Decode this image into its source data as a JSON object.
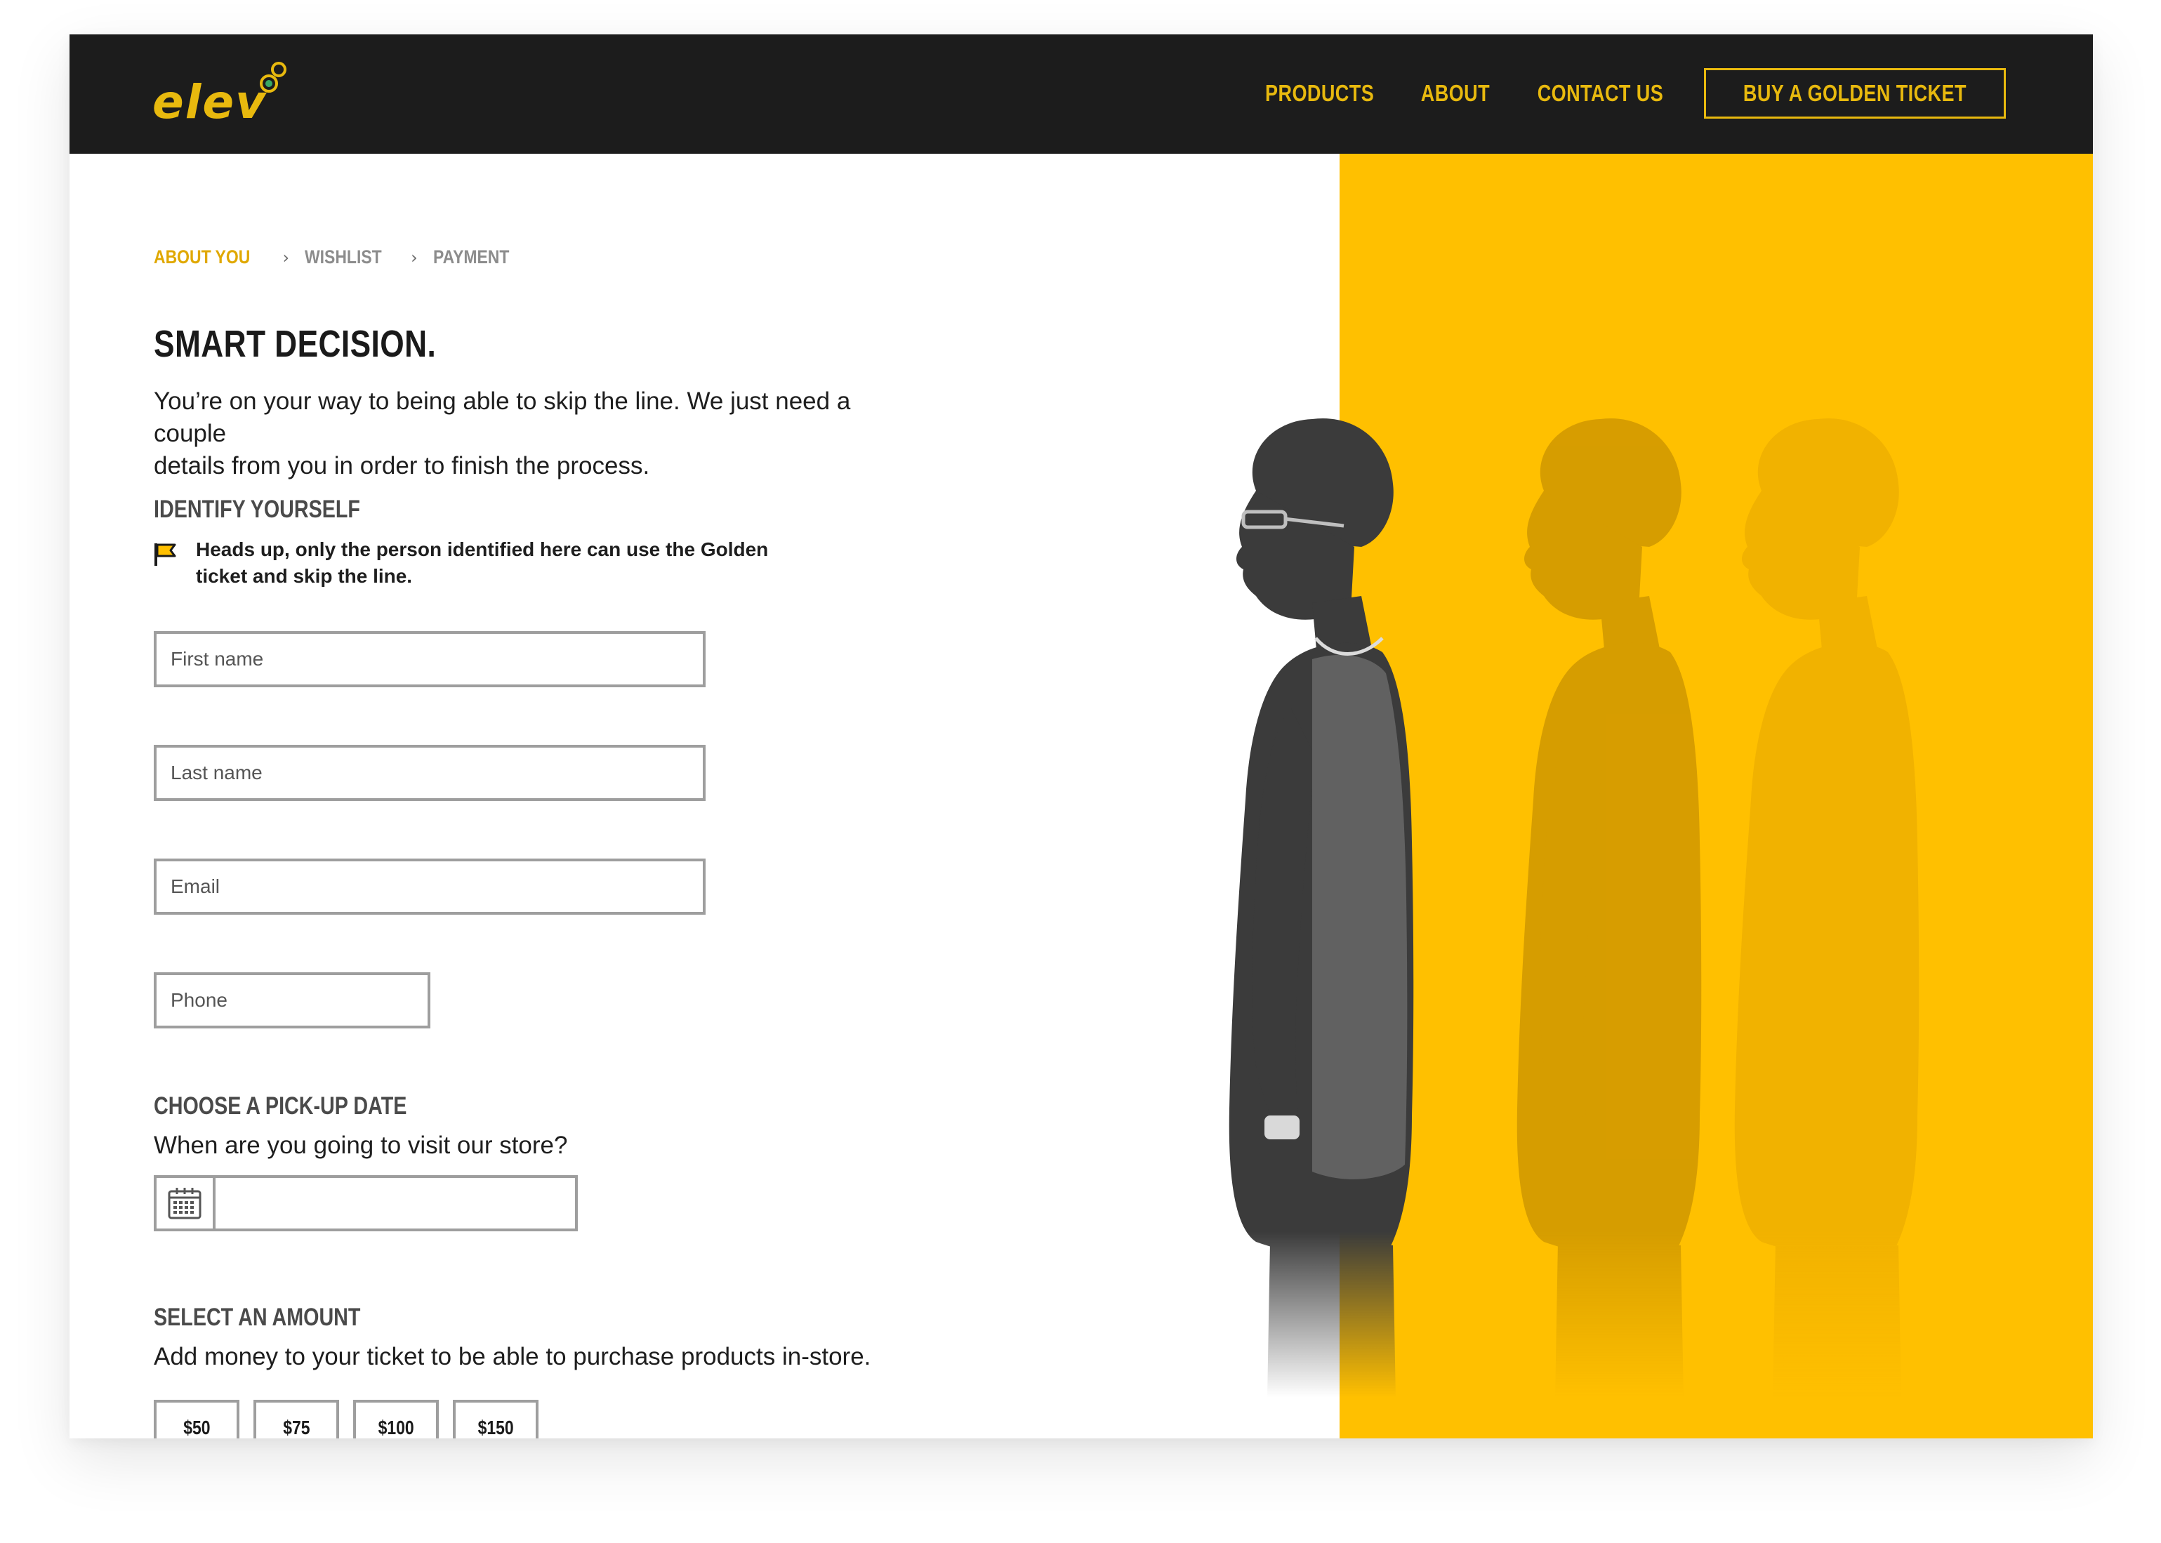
{
  "brand": {
    "logo_text": "elev",
    "accent_color": "#e8b90e",
    "panel_color": "#ffc000",
    "nav_bg": "#1c1c1c"
  },
  "nav": {
    "links": [
      "PRODUCTS",
      "ABOUT",
      "CONTACT US"
    ],
    "cta_label": "BUY A GOLDEN TICKET"
  },
  "breadcrumb": {
    "steps": [
      "ABOUT YOU",
      "WISHLIST",
      "PAYMENT"
    ],
    "active_index": 0,
    "separator_icon": "chevron-right-icon"
  },
  "page": {
    "title": "SMART DECISION.",
    "intro_line_1": "You’re on your way to being able to skip the line. We just need a couple",
    "intro_line_2": "details from you in order to finish the process."
  },
  "identify": {
    "heading": "IDENTIFY YOURSELF",
    "notice_icon": "flag-icon",
    "notice_line_1": "Heads up, only the person identified here can use the Golden",
    "notice_line_2": "ticket and skip the line.",
    "fields": {
      "first_name": {
        "placeholder": "First name",
        "value": ""
      },
      "last_name": {
        "placeholder": "Last name",
        "value": ""
      },
      "email": {
        "placeholder": "Email",
        "value": ""
      },
      "phone": {
        "placeholder": "Phone",
        "value": ""
      }
    }
  },
  "pickup": {
    "heading": "CHOOSE A PICK-UP DATE",
    "subtitle": "When are you going to visit our store?",
    "date_icon": "calendar-icon",
    "date_value": ""
  },
  "amount": {
    "heading": "SELECT AN AMOUNT",
    "subtitle": "Add money to your ticket to be able to purchase products in-store.",
    "options": [
      "$50",
      "$75",
      "$100",
      "$150"
    ]
  },
  "hero_image": {
    "description_icon": "person-silhouette-image",
    "repeat_count": 3
  }
}
